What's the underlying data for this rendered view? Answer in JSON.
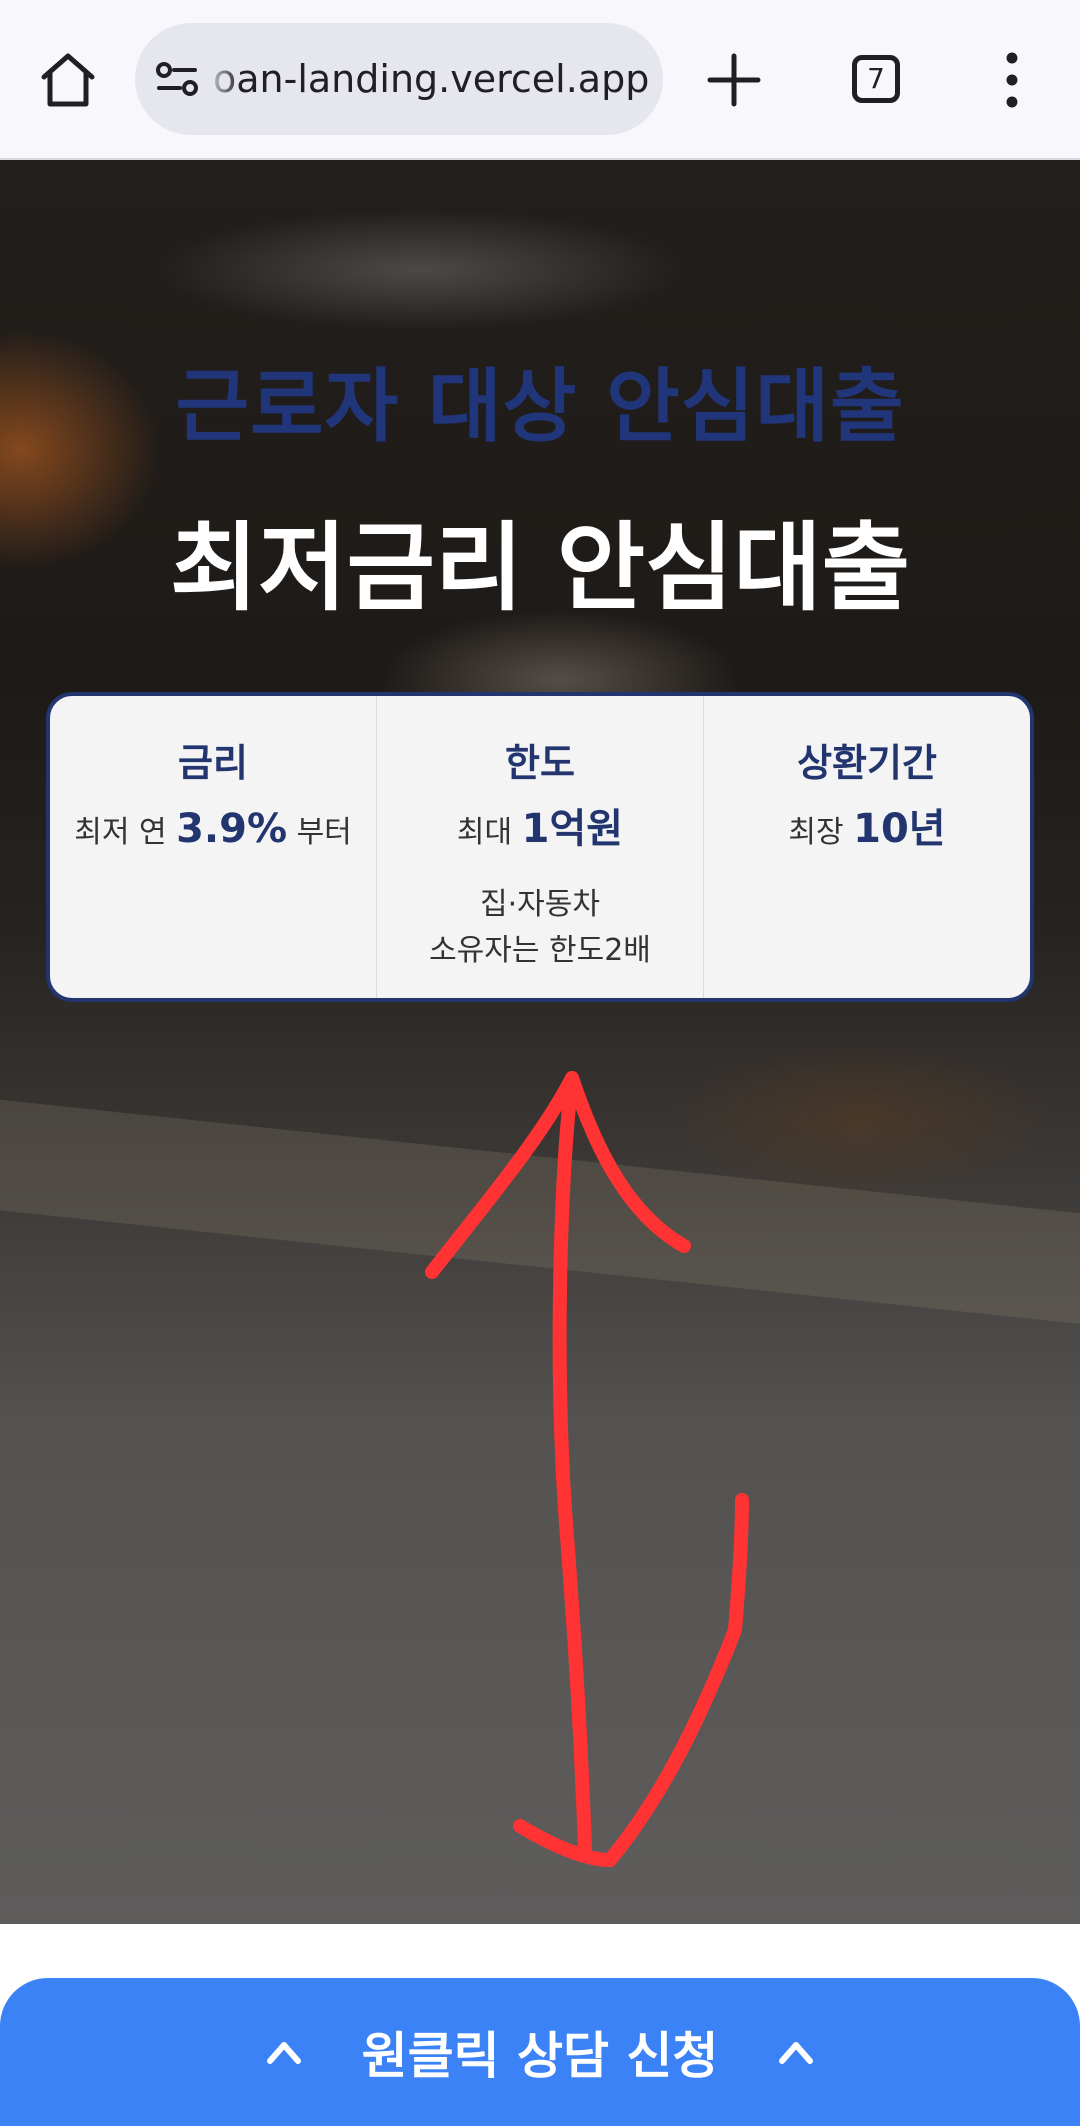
{
  "browser": {
    "url": "oan-landing.vercel.app",
    "tab_count": "7",
    "icons": {
      "home": "home-icon",
      "site_settings": "tune-icon",
      "new_tab": "plus-icon",
      "tabs": "tab-switcher-icon",
      "menu": "more-vert-icon"
    }
  },
  "hero": {
    "subtitle": "근로자 대상 안심대출",
    "title": "최저금리 안심대출"
  },
  "card": {
    "columns": [
      {
        "title": "금리",
        "value_prefix": "최저 연 ",
        "value_highlight": "3.9%",
        "value_suffix": " 부터",
        "note_line1": "",
        "note_line2": ""
      },
      {
        "title": "한도",
        "value_prefix": "최대 ",
        "value_highlight": "1억원",
        "value_suffix": "",
        "note_line1": "집·자동차",
        "note_line2": "소유자는 한도2배"
      },
      {
        "title": "상환기간",
        "value_prefix": "최장 ",
        "value_highlight": "10년",
        "value_suffix": "",
        "note_line1": "",
        "note_line2": ""
      }
    ]
  },
  "cta": {
    "label": "원클릭 상담 신청",
    "icon": "chevron-up-icon"
  },
  "colors": {
    "brand_navy": "#22356f",
    "cta_blue": "#3b82f6",
    "annotation_red": "#ff3333"
  }
}
